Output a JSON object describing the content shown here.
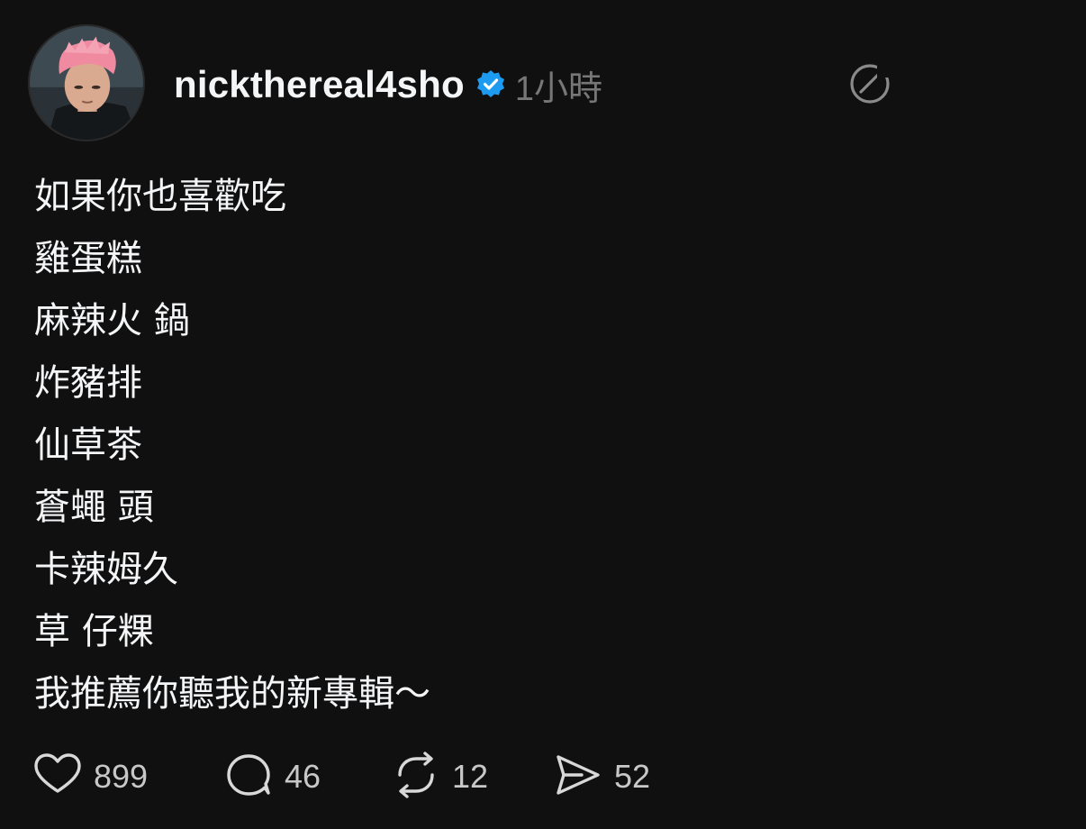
{
  "post": {
    "username": "nickthereal4sho",
    "verified": true,
    "timestamp": "1小時",
    "lines": [
      "如果你也喜歡吃",
      "雞蛋糕",
      "麻辣火 鍋",
      "炸豬排",
      "仙草茶",
      "蒼蠅 頭",
      "卡辣姆久",
      "草 仔粿",
      "我推薦你聽我的新專輯～"
    ]
  },
  "actions": {
    "likes": "899",
    "replies": "46",
    "reposts": "12",
    "shares": "52"
  },
  "colors": {
    "background": "#101010",
    "text": "#f3f5f7",
    "muted": "#777777",
    "verified": "#1d9bf0",
    "avatar_hair": "#f08aa0"
  },
  "icons": [
    "verified-badge-icon",
    "more-options-icon",
    "heart-icon",
    "comment-icon",
    "repost-icon",
    "share-icon"
  ]
}
